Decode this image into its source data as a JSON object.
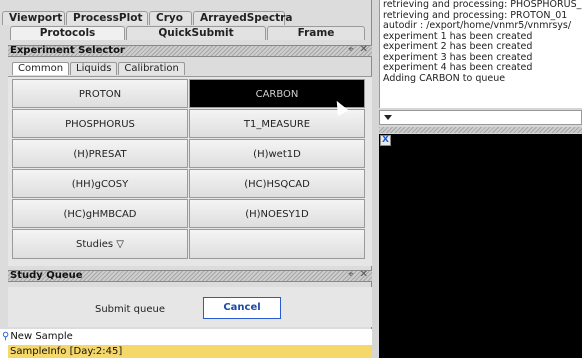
{
  "tabs_row1": [
    "Viewport",
    "ProcessPlot",
    "Cryo",
    "ArrayedSpectra"
  ],
  "tabs_row2": [
    "Protocols",
    "QuickSubmit",
    "Frame"
  ],
  "experiment_selector": {
    "title": "Experiment Selector",
    "controls": [
      "pin-icon",
      "close-icon"
    ],
    "subtabs": [
      "Common",
      "Liquids",
      "Calibration"
    ],
    "buttons": [
      "PROTON",
      "CARBON",
      "PHOSPHORUS",
      "T1_MEASURE",
      "(H)PRESAT",
      "(H)wet1D",
      "(HH)gCOSY",
      "(HC)HSQCAD",
      "(HC)gHMBCAD",
      "(H)NOESY1D",
      "Studies ▽",
      ""
    ],
    "selected": "CARBON"
  },
  "study_queue": {
    "title": "Study Queue",
    "submit_label": "Submit queue",
    "cancel_label": "Cancel",
    "tree": {
      "root": "New Sample",
      "child": "SampleInfo [Day:2:45]"
    }
  },
  "log": {
    "lines": [
      "retrieving and processing: PHOSPHORUS_",
      "retrieving and processing: PROTON_01",
      "autodir : /export/home/vnmr5/vnmrsys/",
      "experiment 1 has been created",
      "experiment 2 has been created",
      "experiment 3 has been created",
      "experiment 4 has been created",
      "Adding CARBON to queue"
    ]
  },
  "graphics_close_label": "X",
  "colors": {
    "accent": "#1c5fd0",
    "tree_highlight": "#f6d86a",
    "selected_button": "#000000"
  }
}
